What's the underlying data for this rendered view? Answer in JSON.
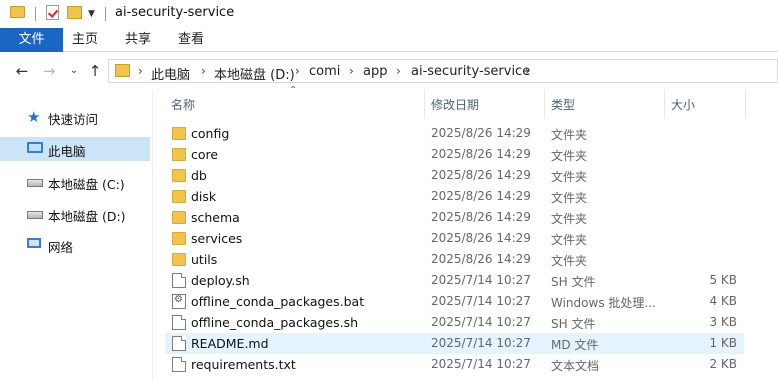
{
  "window": {
    "title": "ai-security-service"
  },
  "ribbon": {
    "tabs": [
      "文件",
      "主页",
      "共享",
      "查看"
    ]
  },
  "address": {
    "crumbs": [
      "此电脑",
      "本地磁盘 (D:)",
      "comi",
      "app",
      "ai-security-service"
    ]
  },
  "nav": {
    "items": [
      {
        "label": "快速访问",
        "icon": "quick-access-star-icon"
      },
      {
        "label": "此电脑",
        "icon": "this-pc-icon",
        "selected": true
      },
      {
        "label": "本地磁盘 (C:)",
        "icon": "drive-icon"
      },
      {
        "label": "本地磁盘 (D:)",
        "icon": "drive-icon"
      },
      {
        "label": "网络",
        "icon": "network-icon"
      }
    ]
  },
  "columns": {
    "name": "名称",
    "date": "修改日期",
    "type": "类型",
    "size": "大小"
  },
  "files": [
    {
      "name": "config",
      "date": "2025/8/26 14:29",
      "type": "文件夹",
      "size": "",
      "kind": "folder"
    },
    {
      "name": "core",
      "date": "2025/8/26 14:29",
      "type": "文件夹",
      "size": "",
      "kind": "folder"
    },
    {
      "name": "db",
      "date": "2025/8/26 14:29",
      "type": "文件夹",
      "size": "",
      "kind": "folder"
    },
    {
      "name": "disk",
      "date": "2025/8/26 14:29",
      "type": "文件夹",
      "size": "",
      "kind": "folder"
    },
    {
      "name": "schema",
      "date": "2025/8/26 14:29",
      "type": "文件夹",
      "size": "",
      "kind": "folder"
    },
    {
      "name": "services",
      "date": "2025/8/26 14:29",
      "type": "文件夹",
      "size": "",
      "kind": "folder"
    },
    {
      "name": "utils",
      "date": "2025/8/26 14:29",
      "type": "文件夹",
      "size": "",
      "kind": "folder"
    },
    {
      "name": "deploy.sh",
      "date": "2025/7/14 10:27",
      "type": "SH 文件",
      "size": "5 KB",
      "kind": "file"
    },
    {
      "name": "offline_conda_packages.bat",
      "date": "2025/7/14 10:27",
      "type": "Windows 批处理...",
      "size": "4 KB",
      "kind": "bat"
    },
    {
      "name": "offline_conda_packages.sh",
      "date": "2025/7/14 10:27",
      "type": "SH 文件",
      "size": "3 KB",
      "kind": "file"
    },
    {
      "name": "README.md",
      "date": "2025/7/14 10:27",
      "type": "MD 文件",
      "size": "1 KB",
      "kind": "file",
      "selected": true
    },
    {
      "name": "requirements.txt",
      "date": "2025/7/14 10:27",
      "type": "文本文档",
      "size": "2 KB",
      "kind": "file"
    }
  ]
}
